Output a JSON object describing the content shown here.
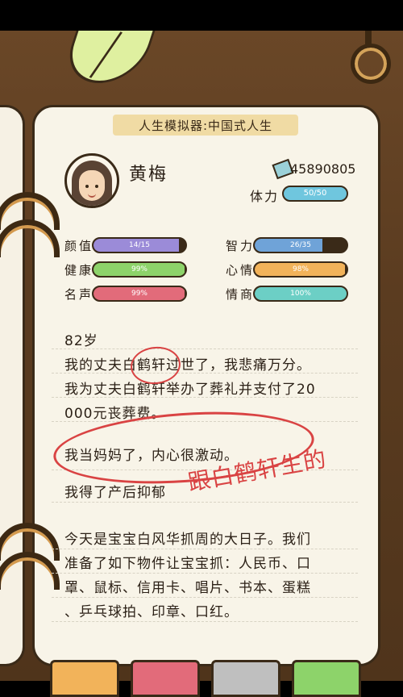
{
  "app": {
    "title": "人生模拟器:中国式人生"
  },
  "profile": {
    "name": "黄梅",
    "money": "45890805",
    "stamina_label": "体力",
    "stamina_value": "50/50"
  },
  "stats": [
    {
      "label": "颜值",
      "value": "14/15",
      "fill": 0.93,
      "color": "#9b8bd8"
    },
    {
      "label": "智力",
      "value": "26/35",
      "fill": 0.74,
      "color": "#6fa3d8"
    },
    {
      "label": "健康",
      "value": "99%",
      "fill": 0.99,
      "color": "#8dd36a"
    },
    {
      "label": "心情",
      "value": "98%",
      "fill": 0.98,
      "color": "#f2b35a"
    },
    {
      "label": "名声",
      "value": "99%",
      "fill": 0.99,
      "color": "#e26b7a"
    },
    {
      "label": "情商",
      "value": "100%",
      "fill": 1.0,
      "color": "#6ccfc5"
    }
  ],
  "story": {
    "age": "82岁",
    "line1": "我的丈夫白鹤轩过世了，我悲痛万分。",
    "line2": "我为丈夫白鹤轩举办了葬礼并支付了20",
    "line3": "000元丧葬费。",
    "line4": "我当妈妈了，内心很激动。",
    "line5": "我得了产后抑郁",
    "line6": "今天是宝宝白风华抓周的大日子。我们",
    "line7": "准备了如下物件让宝宝抓：人民币、口",
    "line8": "罩、鼠标、信用卡、唱片、书本、蛋糕",
    "line9": "、乒乓球拍、印章、口红。"
  },
  "annotation": {
    "text": "跟白鹤轩生的",
    "color": "#d94343"
  },
  "tabs": [
    {
      "color": "#f2b35a"
    },
    {
      "color": "#e26b7a"
    },
    {
      "color": "#bfbfbf"
    },
    {
      "color": "#8dd36a"
    }
  ]
}
